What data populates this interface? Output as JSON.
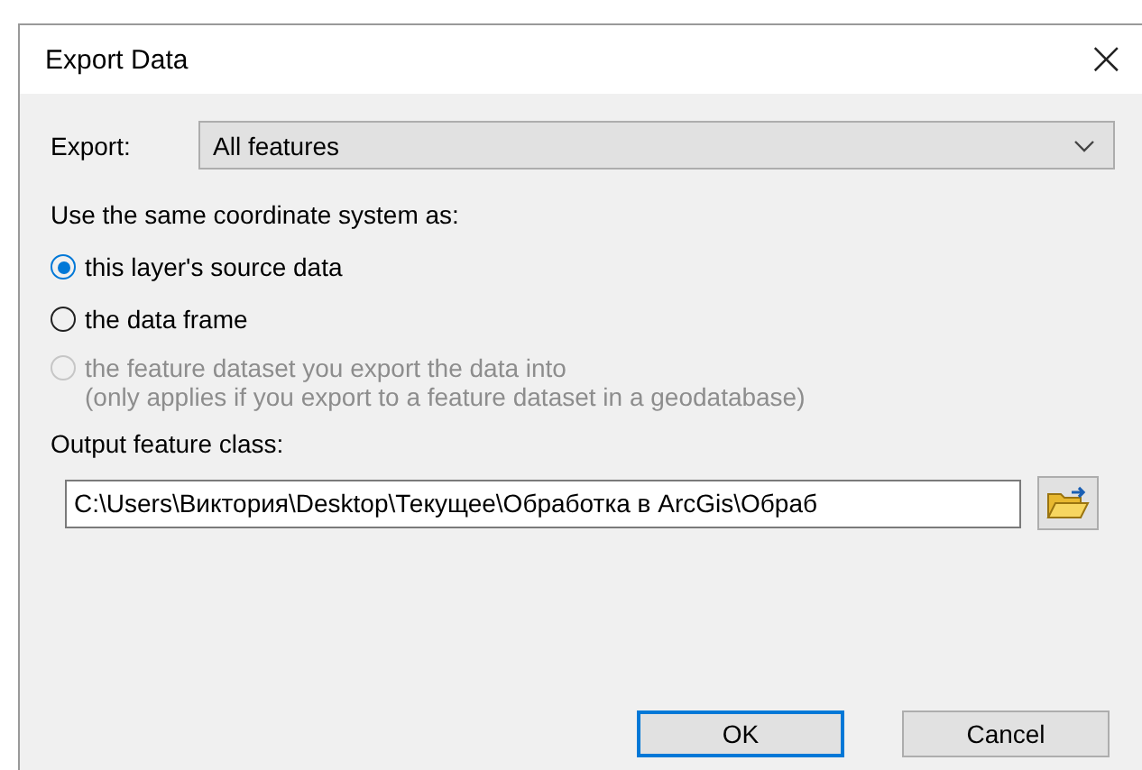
{
  "window": {
    "title": "Export Data",
    "close": "×"
  },
  "export": {
    "label": "Export:",
    "value": "All features"
  },
  "coordinate_prompt": "Use the same coordinate system as:",
  "options": [
    {
      "label": "this layer's source data",
      "selected": true,
      "disabled": false
    },
    {
      "label": "the data frame",
      "selected": false,
      "disabled": false
    },
    {
      "label": "the feature dataset you export the data into",
      "note": "(only applies if you export to a feature dataset in a geodatabase)",
      "selected": false,
      "disabled": true
    }
  ],
  "output": {
    "label": "Output feature class:",
    "value": "C:\\Users\\Виктория\\Desktop\\Текущее\\Обработка в ArcGis\\Обраб"
  },
  "buttons": [
    {
      "label": "OK",
      "selected": true
    },
    {
      "label": "Cancel",
      "selected": false
    }
  ]
}
